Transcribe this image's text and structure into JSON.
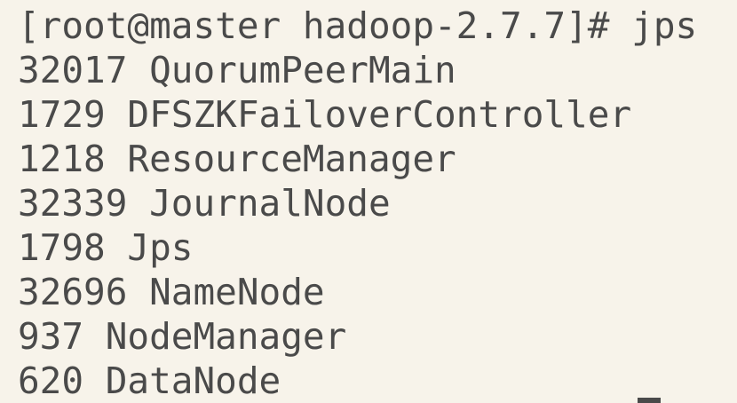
{
  "terminal": {
    "prompt_line": "[root@master hadoop-2.7.7]# jps",
    "output": [
      "32017 QuorumPeerMain",
      "1729 DFSZKFailoverController",
      "1218 ResourceManager",
      "32339 JournalNode",
      "1798 Jps",
      "32696 NameNode",
      "937 NodeManager",
      "620 DataNode"
    ]
  },
  "colors": {
    "background": "#f7f3ea",
    "text": "#4a4a4a"
  }
}
